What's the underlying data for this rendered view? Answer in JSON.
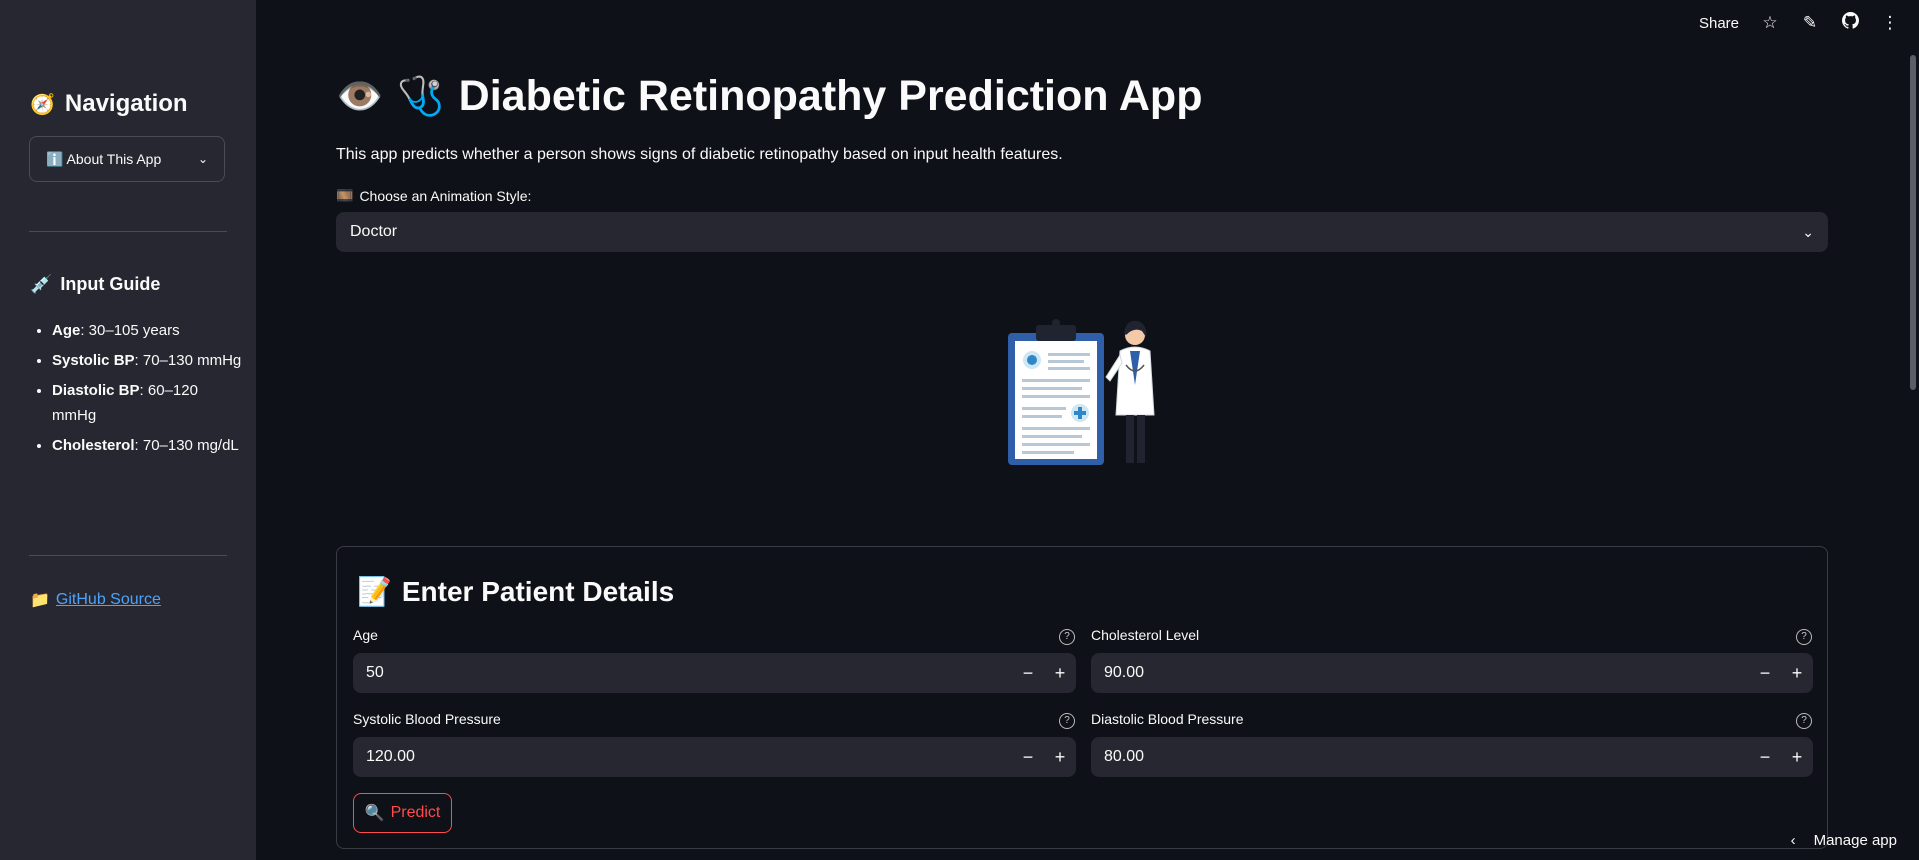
{
  "sidebar": {
    "title": "Navigation",
    "title_icon": "compass-icon",
    "select_label": "ℹ️ About This App",
    "guide_title": "Input Guide",
    "guide_icon": "syringe-icon",
    "guide": [
      {
        "label": "Age",
        "text": ": 30–105 years"
      },
      {
        "label": "Systolic BP",
        "text": ": 70–130 mmHg"
      },
      {
        "label": "Diastolic BP",
        "text": ": 60–120 mmHg"
      },
      {
        "label": "Cholesterol",
        "text": ": 70–130 mg/dL"
      }
    ],
    "link_text": "GitHub Source",
    "link_icon": "folder-icon"
  },
  "topbar": {
    "share_label": "Share",
    "icons": [
      "star-icon",
      "pencil-icon",
      "github-icon",
      "more-vertical-icon"
    ]
  },
  "main": {
    "title": "Diabetic Retinopathy Prediction App",
    "title_icons": [
      "eye-icon",
      "stethoscope-icon"
    ],
    "subtitle": "This app predicts whether a person shows signs of diabetic retinopathy based on input health features.",
    "select_label": "Choose an Animation Style:",
    "select_icon": "film-icon",
    "select_value": "Doctor"
  },
  "form": {
    "title": "Enter Patient Details",
    "title_icon": "memo-icon",
    "fields": {
      "age": {
        "label": "Age",
        "value": "50"
      },
      "cholesterol": {
        "label": "Cholesterol Level",
        "value": "90.00"
      },
      "systolic": {
        "label": "Systolic Blood Pressure",
        "value": "120.00"
      },
      "diastolic": {
        "label": "Diastolic Blood Pressure",
        "value": "80.00"
      }
    },
    "predict_label": "Predict",
    "predict_icon": "magnifier-icon"
  },
  "footer": {
    "manage_label": "Manage app"
  },
  "colors": {
    "background": "#0e1117",
    "sidebar": "#262730",
    "accent": "#ff4b4b",
    "link": "#4ea3f8"
  }
}
